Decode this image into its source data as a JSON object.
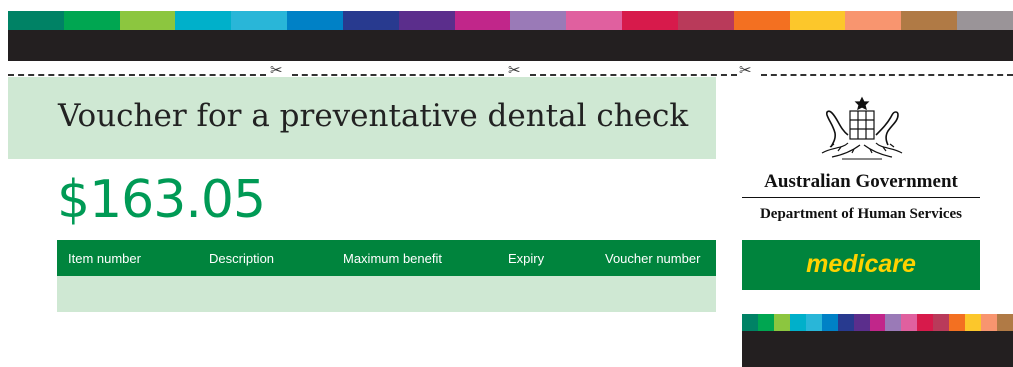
{
  "stripe_colors": [
    "#008265",
    "#00a651",
    "#8cc63f",
    "#00b0ca",
    "#29b6d8",
    "#0081c6",
    "#283a8f",
    "#5b2e8c",
    "#c1268a",
    "#9a7ab7",
    "#e0609f",
    "#d71a4b",
    "#b93a5a",
    "#f37021",
    "#fcc72b",
    "#f8956f",
    "#b07a45",
    "#9a9498"
  ],
  "small_stripe_colors": [
    "#008265",
    "#00a651",
    "#8cc63f",
    "#00b0ca",
    "#29b6d8",
    "#0081c6",
    "#283a8f",
    "#5b2e8c",
    "#c1268a",
    "#9a7ab7",
    "#e0609f",
    "#d71a4b",
    "#b93a5a",
    "#f37021",
    "#fcc72b",
    "#f8956f",
    "#b07a45"
  ],
  "cut_line": {
    "scissors_glyph": "✂"
  },
  "voucher": {
    "title": "Voucher for a preventative dental check",
    "amount": "$163.05",
    "table_headers": [
      "Item number",
      "Description",
      "Maximum benefit",
      "Expiry",
      "Voucher number"
    ]
  },
  "branding": {
    "government": "Australian Government",
    "department": "Department of Human Services",
    "program": "medicare",
    "crest_icon": "commonwealth-coat-of-arms-icon"
  },
  "colors": {
    "brand_green": "#00843d",
    "amount_green": "#009a55",
    "light_green": "#cfe8d3",
    "medicare_yellow": "#ffd200",
    "dark_bar": "#231f20"
  }
}
